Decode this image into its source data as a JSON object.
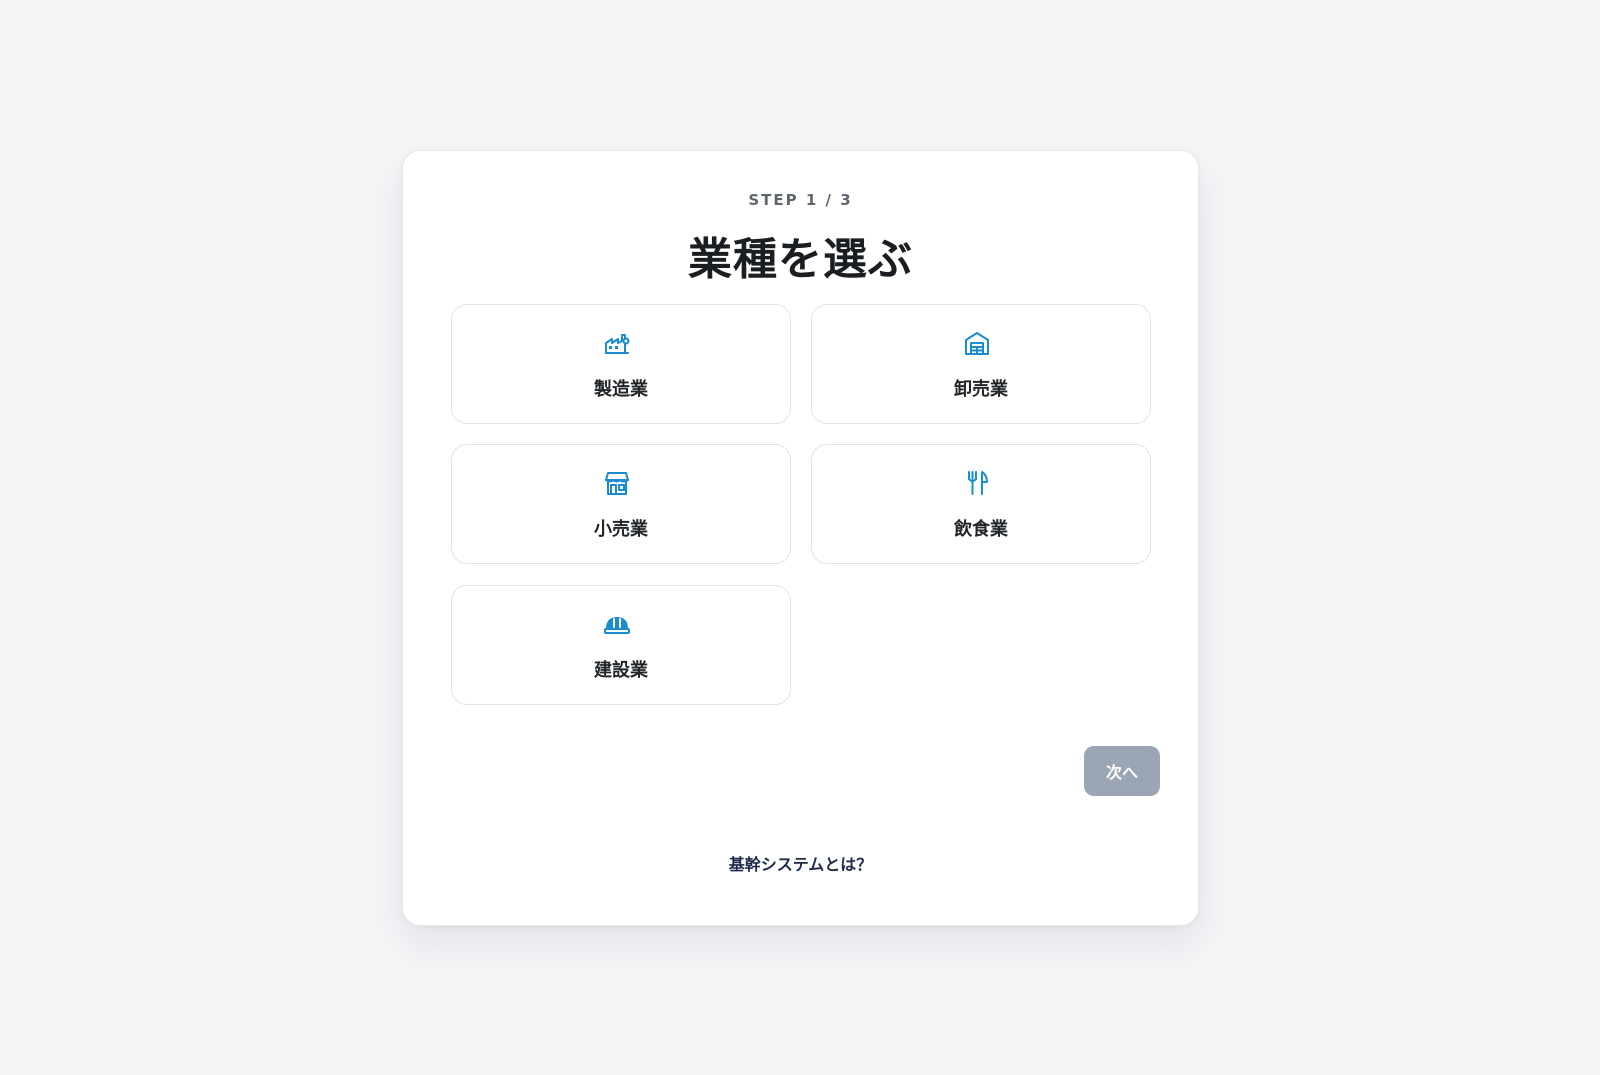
{
  "step_label": "STEP 1 / 3",
  "title": "業種を選ぶ",
  "accent_color": "#1a8ccf",
  "options": [
    {
      "label": "製造業",
      "icon": "factory-icon"
    },
    {
      "label": "卸売業",
      "icon": "warehouse-icon"
    },
    {
      "label": "小売業",
      "icon": "storefront-icon"
    },
    {
      "label": "飲食業",
      "icon": "fork-knife-icon"
    },
    {
      "label": "建設業",
      "icon": "hard-hat-icon"
    }
  ],
  "next_button": {
    "label": "次へ",
    "color": "#9aa6b4"
  },
  "help_link": {
    "label": "基幹システムとは？"
  }
}
